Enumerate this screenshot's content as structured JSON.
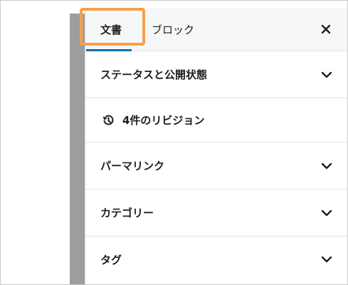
{
  "tabs": {
    "document": "文書",
    "block": "ブロック"
  },
  "panels": [
    {
      "label": "ステータスと公開状態",
      "icon": "chevron-down-icon"
    },
    {
      "label": "4件のリビジョン",
      "icon": "revision-history-icon"
    },
    {
      "label": "パーマリンク",
      "icon": "chevron-down-icon"
    },
    {
      "label": "カテゴリー",
      "icon": "chevron-down-icon"
    },
    {
      "label": "タグ",
      "icon": "chevron-down-icon"
    }
  ],
  "icons": {
    "close": "close-icon"
  },
  "colors": {
    "active_tab_underline": "#0073aa",
    "highlight_outline": "#f5a04a",
    "divider": "#e2e4e7",
    "text": "#1e1e1e"
  }
}
